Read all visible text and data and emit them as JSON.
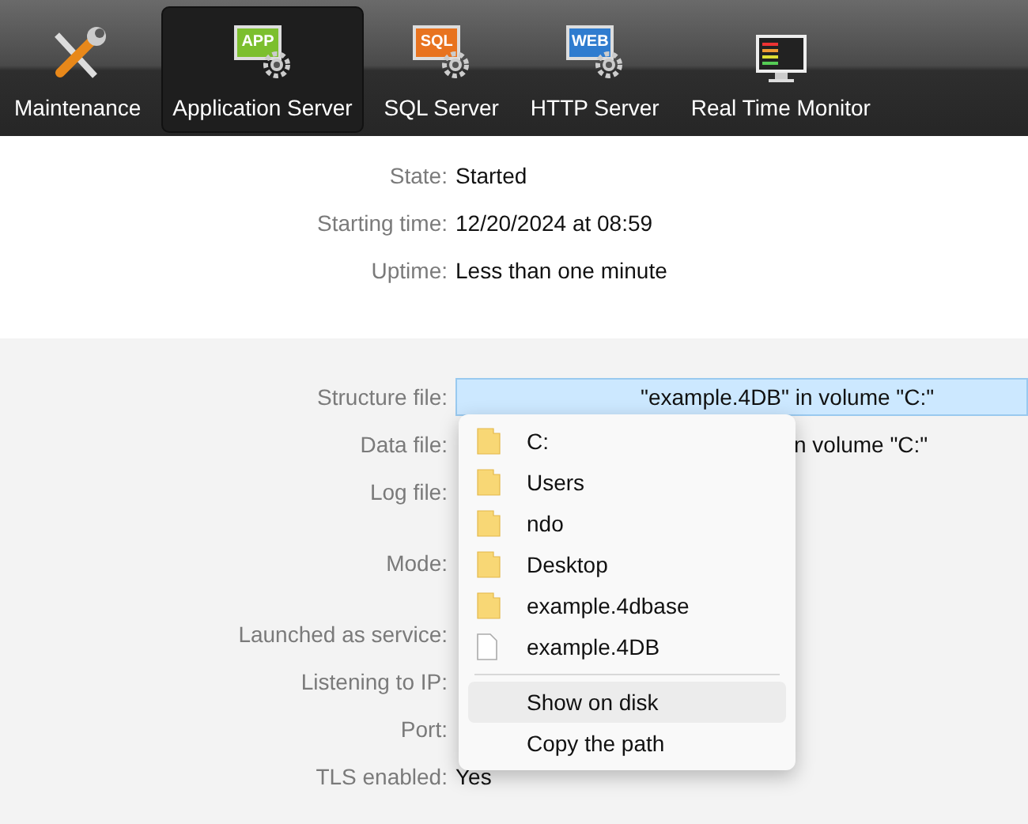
{
  "toolbar": [
    {
      "label": "Maintenance",
      "kind": "tools",
      "selected": false
    },
    {
      "label": "Application Server",
      "kind": "app",
      "badge": "APP",
      "selected": true
    },
    {
      "label": "SQL Server",
      "kind": "sql",
      "badge": "SQL",
      "selected": false
    },
    {
      "label": "HTTP Server",
      "kind": "web",
      "badge": "WEB",
      "selected": false
    },
    {
      "label": "Real Time Monitor",
      "kind": "monitor",
      "selected": false
    }
  ],
  "status": [
    {
      "label": "State:",
      "value": "Started"
    },
    {
      "label": "Starting time:",
      "value": "12/20/2024 at 08:59"
    },
    {
      "label": "Uptime:",
      "value": "Less than one minute"
    }
  ],
  "details": [
    {
      "label": "Structure file:",
      "value": "\"example.4DB\" in volume \"C:\"",
      "kind": "field"
    },
    {
      "label": "Data file:",
      "value": "n volume \"C:\"",
      "kind": "partial"
    },
    {
      "label": "Log file:",
      "kind": "empty"
    },
    {
      "label": "Mode:",
      "kind": "tall"
    },
    {
      "label": "Launched as service:",
      "kind": "empty"
    },
    {
      "label": "Listening to IP:",
      "kind": "empty"
    },
    {
      "label": "Port:",
      "kind": "empty"
    },
    {
      "label": "TLS enabled:",
      "value": "Yes",
      "kind": "text"
    }
  ],
  "context_menu": {
    "items": [
      {
        "label": "C:",
        "kind": "folder"
      },
      {
        "label": "Users",
        "kind": "folder"
      },
      {
        "label": "ndo",
        "kind": "folder"
      },
      {
        "label": "Desktop",
        "kind": "folder"
      },
      {
        "label": "example.4dbase",
        "kind": "folder"
      },
      {
        "label": "example.4DB",
        "kind": "file"
      },
      {
        "kind": "separator"
      },
      {
        "label": "Show on disk",
        "kind": "action",
        "selected": true
      },
      {
        "label": "Copy the path",
        "kind": "action",
        "selected": false
      }
    ]
  }
}
